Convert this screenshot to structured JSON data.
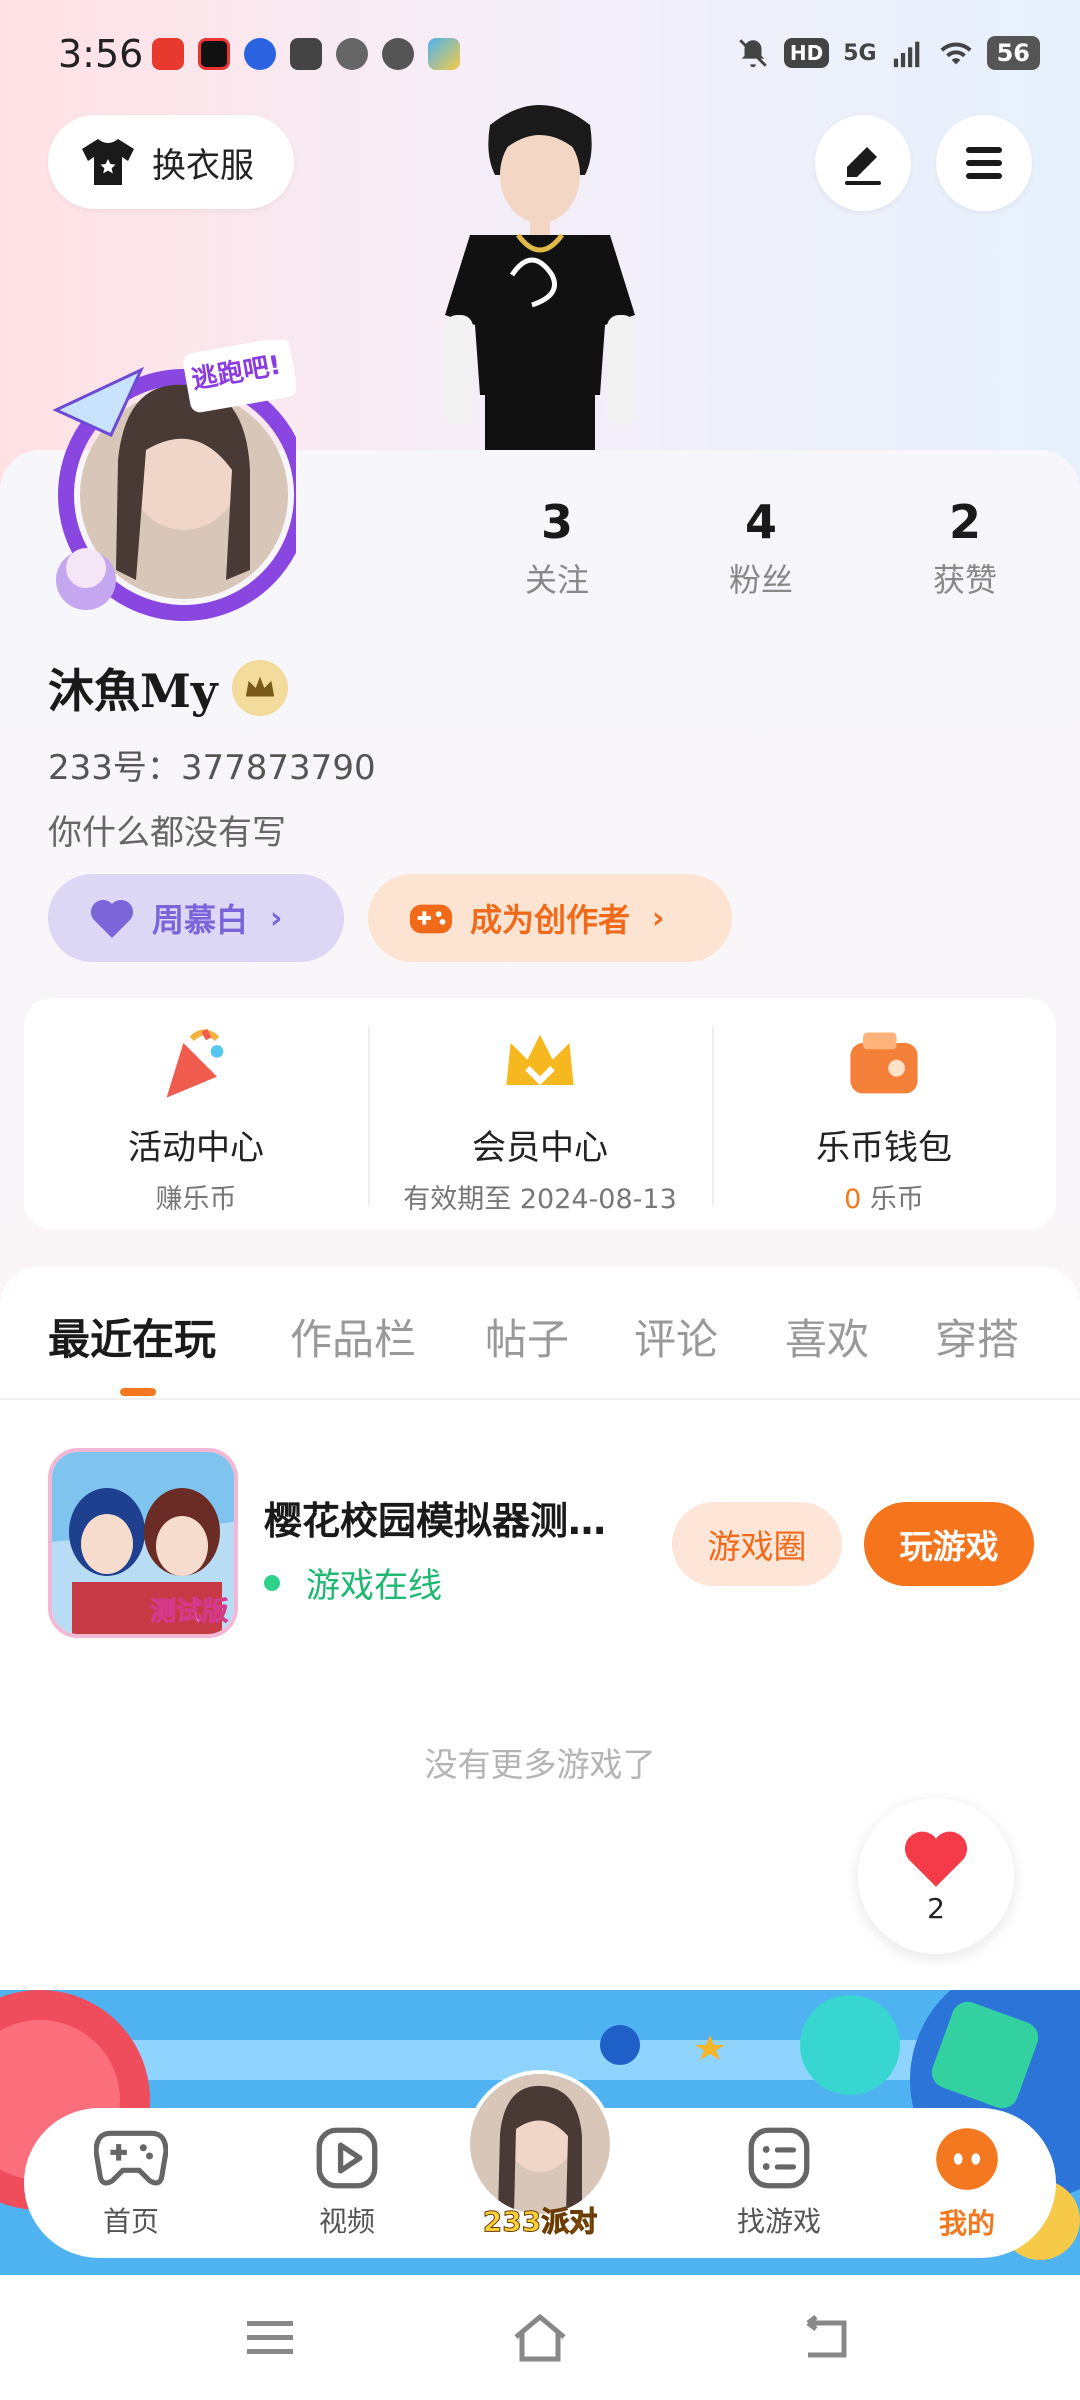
{
  "status_bar": {
    "time": "3:56",
    "network": "5G",
    "hd": "HD",
    "battery": "56"
  },
  "header": {
    "dress_button": "换衣服",
    "edit_icon": "edit-icon",
    "menu_icon": "menu-icon"
  },
  "profile": {
    "stats": [
      {
        "value": "3",
        "label": "关注"
      },
      {
        "value": "4",
        "label": "粉丝"
      },
      {
        "value": "2",
        "label": "获赞"
      }
    ],
    "name": "沐魚My",
    "user_id": "233号：377873790",
    "bio": "你什么都没有写",
    "frame_text": "逃跑吧!",
    "pill_purple": "周慕白",
    "pill_orange": "成为创作者"
  },
  "features": [
    {
      "title": "活动中心",
      "sub": "赚乐币"
    },
    {
      "title": "会员中心",
      "sub": "有效期至 2024-08-13"
    },
    {
      "title": "乐币钱包",
      "sub_value": "0",
      "sub_unit": " 乐币"
    }
  ],
  "tabs": [
    "最近在玩",
    "作品栏",
    "帖子",
    "评论",
    "喜欢",
    "穿搭"
  ],
  "game": {
    "title": "樱花校园模拟器测…",
    "status": "游戏在线",
    "icon_badge": "测试版",
    "circle_button": "游戏圈",
    "play_button": "玩游戏"
  },
  "no_more_text": "没有更多游戏了",
  "like_count": "2",
  "bottom_nav": [
    {
      "label": "首页",
      "icon": "gamepad-icon"
    },
    {
      "label": "视频",
      "icon": "video-icon"
    },
    {
      "label": "233派对",
      "icon": "party-avatar"
    },
    {
      "label": "找游戏",
      "icon": "list-icon"
    },
    {
      "label": "我的",
      "icon": "profile-icon"
    }
  ],
  "colors": {
    "accent": "#f4781f",
    "purple": "#7a65d8",
    "green": "#1db872"
  }
}
